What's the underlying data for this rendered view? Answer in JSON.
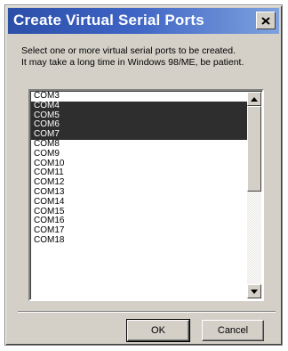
{
  "window": {
    "title": "Create Virtual Serial Ports"
  },
  "instructions": {
    "line1": "Select one or more virtual serial ports to be created.",
    "line2": "It may take a long time in Windows 98/ME, be patient."
  },
  "ports": [
    {
      "label": "COM3",
      "selected": false
    },
    {
      "label": "COM4",
      "selected": true
    },
    {
      "label": "COM5",
      "selected": true
    },
    {
      "label": "COM6",
      "selected": true
    },
    {
      "label": "COM7",
      "selected": true
    },
    {
      "label": "COM8",
      "selected": false
    },
    {
      "label": "COM9",
      "selected": false
    },
    {
      "label": "COM10",
      "selected": false
    },
    {
      "label": "COM11",
      "selected": false
    },
    {
      "label": "COM12",
      "selected": false
    },
    {
      "label": "COM13",
      "selected": false
    },
    {
      "label": "COM14",
      "selected": false
    },
    {
      "label": "COM15",
      "selected": false
    },
    {
      "label": "COM16",
      "selected": false
    },
    {
      "label": "COM17",
      "selected": false
    },
    {
      "label": "COM18",
      "selected": false
    }
  ],
  "buttons": {
    "ok": "OK",
    "cancel": "Cancel"
  },
  "colors": {
    "titlebar_start": "#2c4fa8",
    "titlebar_end": "#7ea2de",
    "selection": "#2e2e2e",
    "dialog_face": "#d4d0c8"
  }
}
